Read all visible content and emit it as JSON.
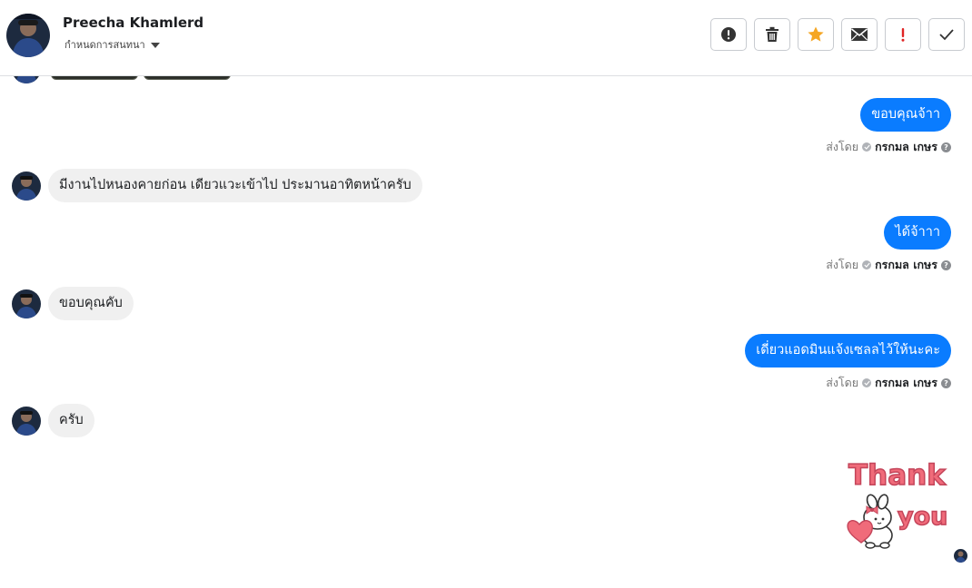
{
  "header": {
    "contact_name": "Preecha Khamlerd",
    "subtitle": "กำหนดการสนทนา",
    "avatar_icon": "profile-photo-avatar",
    "toolbar": [
      {
        "name": "spam-button",
        "icon": "exclamation-circle-icon"
      },
      {
        "name": "delete-button",
        "icon": "trash-icon"
      },
      {
        "name": "star-button",
        "icon": "star-icon",
        "color": "#f5a623"
      },
      {
        "name": "mark-unread-button",
        "icon": "envelope-icon"
      },
      {
        "name": "important-button",
        "icon": "exclamation-icon",
        "color": "#e02424"
      },
      {
        "name": "done-button",
        "icon": "checkmark-icon"
      }
    ]
  },
  "messages": [
    {
      "direction": "out",
      "text": "ขอบคุณจ้าา",
      "sent_by_label": "ส่งโดย",
      "sender": "กรกมล เกษร"
    },
    {
      "direction": "in",
      "text": "มีงานไปหนองคายก่อน  เดียวแวะเข้าไป  ประมานอาทิตหน้าครับ"
    },
    {
      "direction": "out",
      "text": "ได้จ้าาา",
      "sent_by_label": "ส่งโดย",
      "sender": "กรกมล เกษร"
    },
    {
      "direction": "in",
      "text": "ขอบคุณคับ"
    },
    {
      "direction": "out",
      "text": "เดี่ยวแอดมินแจ้งเซลลไว้ให้นะคะ",
      "sent_by_label": "ส่งโดย",
      "sender": "กรกมล เกษร"
    },
    {
      "direction": "in",
      "text": "ครับ"
    }
  ],
  "sticker": {
    "line1": "Thank",
    "line2": "you",
    "color": "#f06b7a"
  },
  "colors": {
    "outgoing_bubble": "#0a7cff",
    "incoming_bubble": "#f0f0f0"
  }
}
